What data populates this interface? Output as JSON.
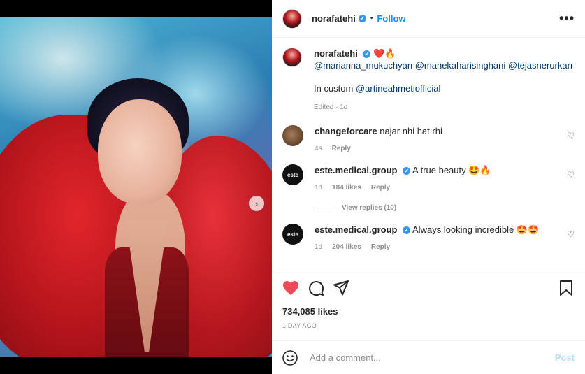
{
  "post": {
    "image_alt": "",
    "carousel": {
      "count": 6,
      "active_index": 0
    }
  },
  "header": {
    "username": "norafatehi",
    "verified_mark": "✔",
    "separator": "•",
    "follow_label": "Follow",
    "more_label": "•••"
  },
  "caption": {
    "username": "norafatehi",
    "emojis": "❤️🔥",
    "mentions": "@marianna_mukuchyan @manekaharisinghani @tejasnerurkarr",
    "custom_text": "In custom",
    "custom_mention": "@artineahmetiofficial",
    "meta": "Edited · 1d"
  },
  "comments": [
    {
      "username": "changeforcare",
      "text": "najar nhi hat rhi",
      "time": "4s",
      "likes": "",
      "reply_label": "Reply",
      "verified": false
    },
    {
      "username": "este.medical.group",
      "text": "A true beauty 🤩🔥",
      "time": "1d",
      "likes": "184 likes",
      "reply_label": "Reply",
      "verified": true,
      "view_replies": "View replies (10)"
    },
    {
      "username": "este.medical.group",
      "text": "Always looking incredible 🤩🤩",
      "time": "1d",
      "likes": "204 likes",
      "reply_label": "Reply",
      "verified": true
    }
  ],
  "este_avatar_text": "este",
  "actions": {
    "likes": "734,085 likes",
    "time_ago": "1 DAY AGO"
  },
  "add_comment": {
    "placeholder": "Add a comment...",
    "post_label": "Post"
  },
  "colors": {
    "accent": "#0095f6",
    "heart": "#ed4956",
    "post_disabled": "#b2dffc"
  }
}
